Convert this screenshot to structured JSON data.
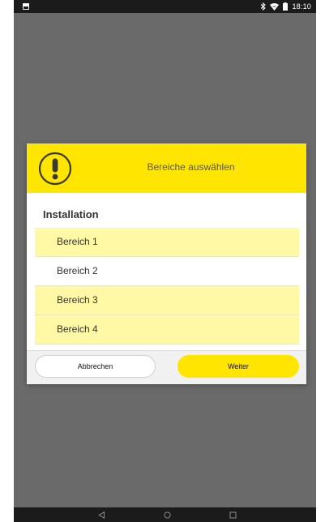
{
  "status_bar": {
    "time": "18:10",
    "icons": [
      "notification-icon",
      "bluetooth-icon",
      "wifi-icon",
      "battery-icon"
    ]
  },
  "dialog": {
    "title": "Bereiche auswählen",
    "header_color": "#ffe500",
    "header_icon": "warning-icon",
    "section_title": "Installation",
    "items": [
      {
        "label": "Bereich 1",
        "selected": true
      },
      {
        "label": "Bereich 2",
        "selected": false
      },
      {
        "label": "Bereich 3",
        "selected": true
      },
      {
        "label": "Bereich 4",
        "selected": true
      }
    ],
    "buttons": {
      "cancel_label": "Abbrechen",
      "next_label": "Weiter"
    }
  },
  "nav_bar": {
    "icons": [
      "back-icon",
      "home-icon",
      "recents-icon"
    ]
  },
  "colors": {
    "accent": "#ffe500",
    "selected_row": "#fff9a6",
    "overlay": "#6a6a6a"
  }
}
